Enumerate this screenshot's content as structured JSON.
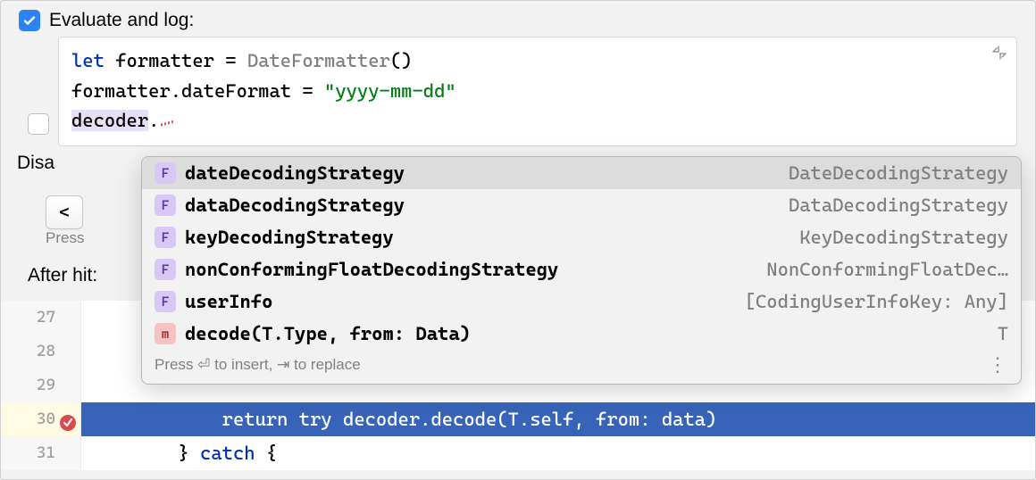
{
  "top": {
    "evaluate_label": "Evaluate and log:"
  },
  "editor": {
    "line1_kw": "let",
    "line1_plain": " formatter = ",
    "line1_type": "DateFormatter",
    "line1_tail": "()",
    "line2_plain": "formatter.dateFormat = ",
    "line2_str": "\"yyyy-mm-dd\"",
    "line3_hl": "decoder",
    "line3_dot": "."
  },
  "labels": {
    "disa": "Disa",
    "after_hit": "After hit:",
    "press_small": "Press ",
    "dropdown_glyph": "<"
  },
  "completion": {
    "items": [
      {
        "badge": "F",
        "badge_class": "f",
        "name": "dateDecodingStrategy",
        "type": "DateDecodingStrategy",
        "selected": true
      },
      {
        "badge": "F",
        "badge_class": "f",
        "name": "dataDecodingStrategy",
        "type": "DataDecodingStrategy",
        "selected": false
      },
      {
        "badge": "F",
        "badge_class": "f",
        "name": "keyDecodingStrategy",
        "type": "KeyDecodingStrategy",
        "selected": false
      },
      {
        "badge": "F",
        "badge_class": "f",
        "name": "nonConformingFloatDecodingStrategy",
        "type": "NonConformingFloatDec…",
        "selected": false
      },
      {
        "badge": "F",
        "badge_class": "f",
        "name": "userInfo",
        "type": "[CodingUserInfoKey: Any]",
        "selected": false
      },
      {
        "badge": "m",
        "badge_class": "m",
        "name": "decode(T.Type, from: Data)",
        "type": "T",
        "selected": false
      }
    ],
    "footer_text": "Press ⏎ to insert, ⇥ to replace"
  },
  "gutter": {
    "lines": [
      "27",
      "28",
      "29",
      "30",
      "31"
    ],
    "highlight_index": 3
  },
  "code_lines": {
    "l27": "",
    "l28": "",
    "l29": "",
    "l30": "            return try decoder.decode(T.self, from: data)",
    "l31_a": "        } ",
    "l31_kw": "catch",
    "l31_b": " {"
  }
}
